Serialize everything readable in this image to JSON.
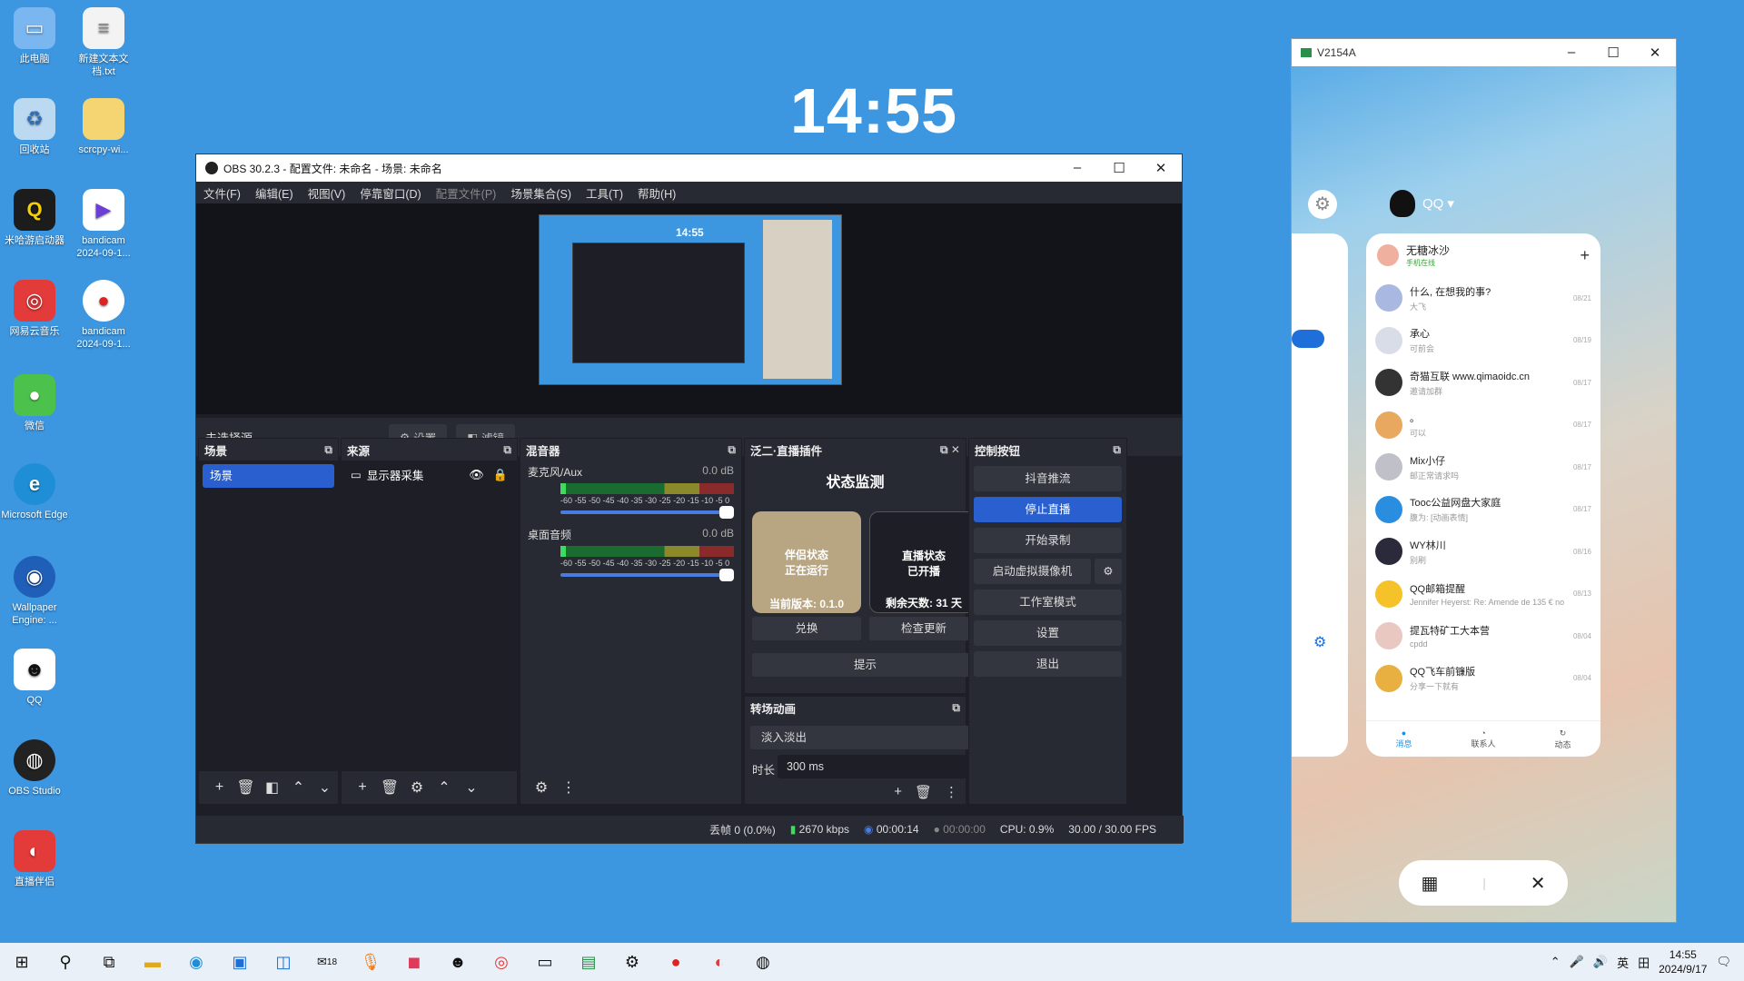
{
  "clock": "14:55",
  "desktop_icons": [
    {
      "label": "此电脑",
      "icon": "computer-icon"
    },
    {
      "label": "新建文本文档.txt",
      "icon": "text-file-icon"
    },
    {
      "label": "回收站",
      "icon": "recycle-bin-icon"
    },
    {
      "label": "scrcpy-wi...",
      "icon": "folder-icon"
    },
    {
      "label": "米哈游启动器",
      "icon": "launcher-icon"
    },
    {
      "label": "bandicam 2024-09-1...",
      "icon": "video-file-icon"
    },
    {
      "label": "网易云音乐",
      "icon": "netease-music-icon"
    },
    {
      "label": "bandicam 2024-09-1...",
      "icon": "bandicam-icon"
    },
    {
      "label": "微信",
      "icon": "wechat-icon"
    },
    {
      "label": "Microsoft Edge",
      "icon": "edge-icon"
    },
    {
      "label": "Wallpaper Engine: ...",
      "icon": "wallpaper-engine-icon"
    },
    {
      "label": "QQ",
      "icon": "qq-icon"
    },
    {
      "label": "OBS Studio",
      "icon": "obs-icon"
    },
    {
      "label": "直播伴侣",
      "icon": "live-companion-icon"
    }
  ],
  "obs": {
    "title": "OBS 30.2.3 - 配置文件: 未命名 - 场景: 未命名",
    "menu": [
      "文件(F)",
      "编辑(E)",
      "视图(V)",
      "停靠窗口(D)",
      "配置文件(P)",
      "场景集合(S)",
      "工具(T)",
      "帮助(H)"
    ],
    "no_source": "未选择源",
    "settings_btn": "设置",
    "filters_btn": "滤镜",
    "preview_clock": "14:55",
    "scenes": {
      "title": "场景",
      "items": [
        "场景"
      ]
    },
    "sources": {
      "title": "来源",
      "items": [
        "显示器采集"
      ]
    },
    "mixer": {
      "title": "混音器",
      "channels": [
        {
          "name": "麦克风/Aux",
          "db": "0.0 dB"
        },
        {
          "name": "桌面音频",
          "db": "0.0 dB"
        }
      ],
      "scale": "-60 -55 -50 -45 -40 -35 -30 -25 -20 -15 -10 -5 0"
    },
    "plugin": {
      "title": "泛二·直播插件",
      "heading": "状态监测",
      "card1_line1": "伴侣状态",
      "card1_line2": "正在运行",
      "card1_bottom": "当前版本: 0.1.0",
      "card2_line1": "直播状态",
      "card2_line2": "已开播",
      "card2_bottom": "剩余天数: 31 天",
      "redeem": "兑换",
      "check_update": "检查更新",
      "tip": "提示"
    },
    "transition": {
      "title": "转场动画",
      "type": "淡入淡出",
      "duration_label": "时长",
      "duration": "300 ms"
    },
    "controls": {
      "title": "控制按钮",
      "buttons": [
        "抖音推流",
        "停止直播",
        "开始录制",
        "启动虚拟摄像机",
        "工作室模式",
        "设置",
        "退出"
      ]
    },
    "status": {
      "dropped": "丢帧 0 (0.0%)",
      "bitrate": "2670 kbps",
      "live_time": "00:00:14",
      "rec_time": "00:00:00",
      "cpu": "CPU: 0.9%",
      "fps": "30.00 / 30.00 FPS"
    }
  },
  "phone": {
    "title": "V2154A",
    "app_label": "QQ",
    "top_user": "无糖冰沙",
    "top_sub": "手机在线",
    "chats": [
      {
        "name": "什么, 在想我的事?",
        "sub": "大飞",
        "date": "08/21"
      },
      {
        "name": "承心",
        "sub": "可前会",
        "date": "08/19"
      },
      {
        "name": "奇猫互联 www.qimaoidc.cn",
        "sub": "邀请加群",
        "date": "08/17"
      },
      {
        "name": "。",
        "sub": "可以",
        "date": "08/17"
      },
      {
        "name": "Mix小仔",
        "sub": "邮正常请求吗",
        "date": "08/17"
      },
      {
        "name": "Tooc公益网盘大家庭",
        "sub": "腹为: [动画表情]",
        "date": "08/17"
      },
      {
        "name": "WY林川",
        "sub": "别刷",
        "date": "08/16"
      },
      {
        "name": "QQ邮箱提醒",
        "sub": "Jennifer Heyerst: Re: Amende de 135 € no",
        "date": "08/13"
      },
      {
        "name": "提瓦特矿工大本营",
        "sub": "cpdd",
        "date": "08/04"
      },
      {
        "name": "QQ飞车前镰版",
        "sub": "分享一下就有",
        "date": "08/04"
      }
    ],
    "tabs": [
      "消息",
      "联系人",
      "动态"
    ]
  },
  "taskbar": {
    "badge": "18",
    "ime": "英",
    "time": "14:55",
    "date": "2024/9/17"
  }
}
